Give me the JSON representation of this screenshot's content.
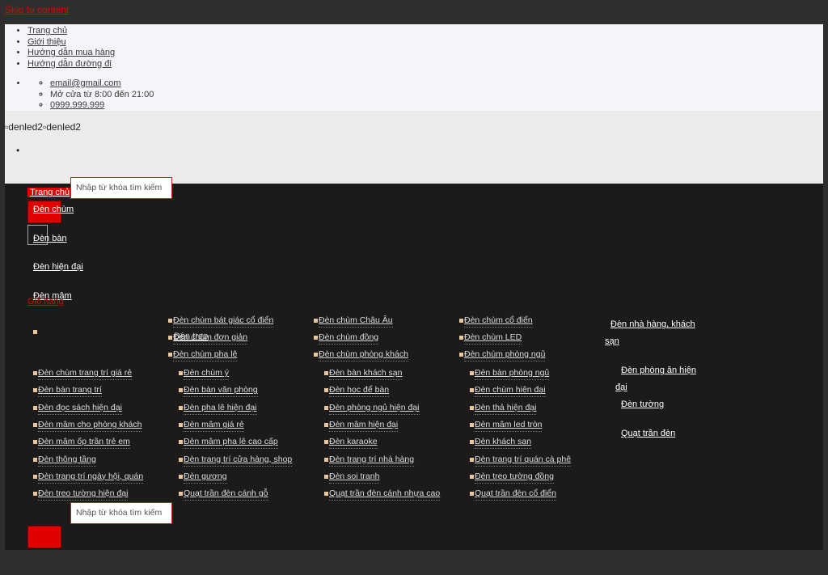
{
  "skip_link": "Skip to content",
  "top_links": [
    "Trang chủ",
    "Giới thiệu",
    "Hướng dẫn mua hàng",
    "Hướng dẫn đường đi"
  ],
  "contact": {
    "email": "email@gmail.com",
    "hours": "Mở cửa từ 8:00 đến 21:00",
    "phone": "0999.999.999"
  },
  "logo_alt": "denled2",
  "search": {
    "placeholder": "Nhập từ khóa tìm kiếm"
  },
  "menu": {
    "home": "Trang chủ",
    "items": [
      "Đèn chùm",
      "Đèn bàn",
      "Đèn hiện đại",
      "Đèn mâm"
    ],
    "cart": "Giỏ hàng",
    "cart_overlay": "Đèn treo"
  },
  "categories": {
    "row1": [
      "Đèn chùm bát giác cổ điển",
      "Đèn chùm Châu Âu",
      "Đèn chùm cổ điển"
    ],
    "row2": [
      "Đèn chùm đơn giản",
      "Đèn chùm đồng",
      "Đèn chùm LED"
    ],
    "row3": [
      "Đèn chùm pha lê",
      "Đèn chùm phòng khách",
      "Đèn chùm phòng ngủ"
    ],
    "grid": [
      [
        "Đèn chùm trang trí giá rẻ",
        "Đèn chùm ý",
        "Đèn bàn khách sạn",
        "Đèn bàn phòng ngủ"
      ],
      [
        "Đèn bàn trang trí",
        "Đèn bàn văn phòng",
        "Đèn học để bàn",
        "Đèn chùm hiện đại"
      ],
      [
        "Đèn đọc sách hiện đại",
        "Đèn pha lê hiện đại",
        "Đèn phòng ngủ hiện đại",
        "Đèn thả hiện đại"
      ],
      [
        "Đèn mâm cho phòng khách",
        "Đèn mâm giá rẻ",
        "Đèn mâm hiện đại",
        "Đèn mâm led tròn"
      ],
      [
        "Đèn mâm ốp trần trẻ em",
        "Đèn mâm pha lê cao cấp",
        "Đèn karaoke",
        "Đèn khách sạn"
      ],
      [
        "Đèn thông tầng",
        "Đèn trang trí cửa hàng, shop",
        "Đèn trang trí nhà hàng",
        "Đèn trang trí quán cà phê"
      ],
      [
        "Đèn trang trí ngày hội, quán",
        "Đèn gương",
        "Đèn soi tranh",
        "Đèn treo tường đồng"
      ],
      [
        "Đèn treo tường hiện đại",
        "Quạt trần đèn cánh gỗ",
        "Quạt trần đèn cánh nhựa cao",
        "Quạt trần đèn cổ điển"
      ]
    ],
    "side": [
      "Đèn nhà hàng, khách sạn",
      "Đèn phòng ăn hiện đại",
      "Đèn tường",
      "Quạt trần đèn"
    ]
  }
}
